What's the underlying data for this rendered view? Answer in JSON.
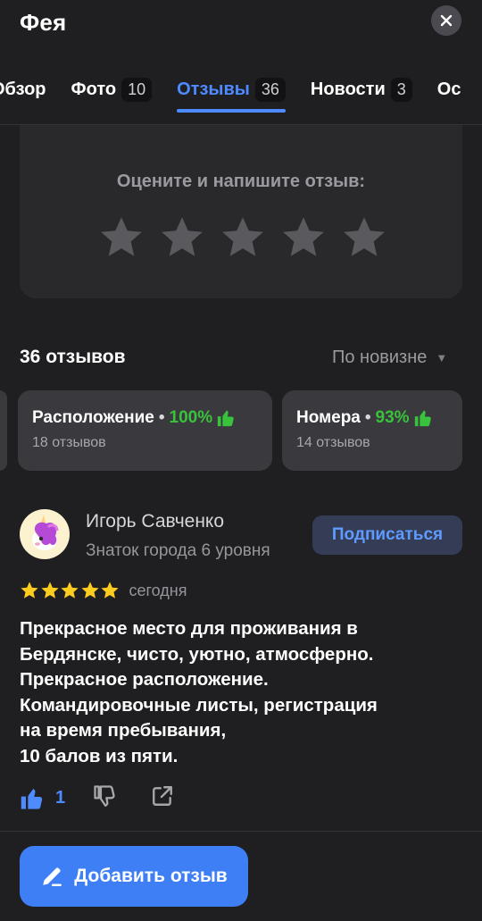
{
  "header": {
    "title": "Фея",
    "tabs": [
      {
        "label": "Обзор",
        "count": ""
      },
      {
        "label": "Фото",
        "count": "10"
      },
      {
        "label": "Отзывы",
        "count": "36"
      },
      {
        "label": "Новости",
        "count": "3"
      },
      {
        "label": "Ос",
        "count": ""
      }
    ]
  },
  "rate_card": {
    "label": "Оцените и напишите отзыв:",
    "stars": 5
  },
  "reviews": {
    "count_label": "36 отзывов",
    "sort_label": "По новизне"
  },
  "aspects": [
    {
      "name": "Расположение",
      "percent": "100%",
      "sub": "18 отзывов"
    },
    {
      "name": "Номера",
      "percent": "93%",
      "sub": "14 отзывов"
    }
  ],
  "review": {
    "author": "Игорь Савченко",
    "level": "Знаток города 6 уровня",
    "subscribe_label": "Подписаться",
    "rating": 5,
    "date": "сегодня",
    "text_lines": [
      "Прекрасное место для проживания в",
      "Бердянске, чисто, уютно, атмосферно.",
      "Прекрасное расположение.",
      "Командировочные листы, регистрация",
      "на время пребывания,",
      "10 балов из пяти."
    ],
    "likes": "1"
  },
  "add_review_label": "Добавить отзыв",
  "colors": {
    "background": "#1f1f21",
    "card": "#29292c",
    "accent_blue": "#4d8bff",
    "button_blue": "#3f7ff6",
    "positive_green": "#39c23c",
    "rating_gold": "#fccc1e"
  }
}
